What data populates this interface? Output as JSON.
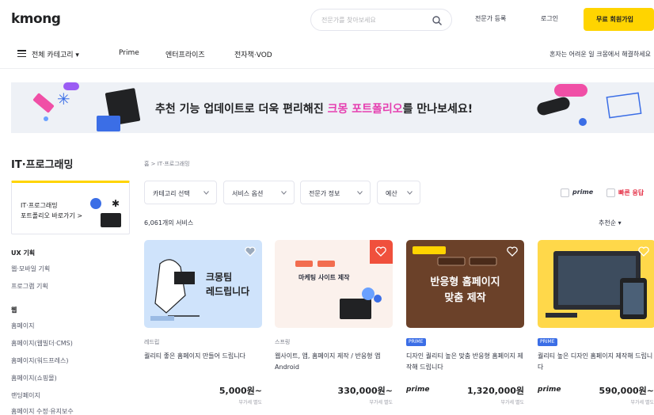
{
  "header": {
    "logo": "kmong",
    "search_placeholder": "전문가를 찾아보세요",
    "links": [
      "전문가 등록",
      "로그인"
    ],
    "join_label": "무료 회원가입"
  },
  "nav": {
    "items": [
      "전체 카테고리 ▾",
      "Prime",
      "엔터프라이즈",
      "전자책·VOD"
    ],
    "right_text": "혼자는 어려운 일 크몽에서 해결하세요"
  },
  "banner": {
    "text_before": "추천 기능 업데이트로 더욱 편리해진 ",
    "highlight": "크몽 포트폴리오",
    "text_after": "를 만나보세요!"
  },
  "sidebar": {
    "title": "IT·프로그래밍",
    "promo": [
      "IT·프로그래밍",
      "포트폴리오 바로가기 >"
    ],
    "sections": [
      {
        "title": "UX 기획",
        "items": [
          "웹·모바일 기획",
          "프로그램 기획"
        ]
      },
      {
        "title": "웹",
        "items": [
          "홈페이지",
          "홈페이지(웹빌더·CMS)",
          "홈페이지(워드프레스)",
          "홈페이지(쇼핑몰)",
          "랜딩페이지",
          "홈페이지 수정·유지보수"
        ]
      }
    ]
  },
  "content": {
    "breadcrumb": "홈 > IT·프로그래밍",
    "filters": [
      "카테고리 선택",
      "서비스 옵션",
      "전문가 정보",
      "예산"
    ],
    "options": [
      "prime",
      "빠른 응답"
    ],
    "count_text": "6,061개의 서비스",
    "sort_label": "추천순 ▾"
  },
  "cards": [
    {
      "thumb_text": "크몽팀\n레드립니다",
      "seller": "레드립",
      "title": "퀄리티 좋은 홈페이지 만들어 드립니다",
      "prime": "",
      "price": "5,000원~",
      "price_sub": "부가세 별도",
      "badge": ""
    },
    {
      "thumb_text": "마케팅 사이트 제작",
      "seller": "스프링",
      "title": "웹사이트, 앱, 홈페이지 제작 / 반응형 앱 Android",
      "prime": "",
      "price": "330,000원~",
      "price_sub": "부가세 별도",
      "badge": ""
    },
    {
      "thumb_text": "반응형 홈페이지\n맞춤 제작",
      "seller": "",
      "title": "디자인 퀄리티 높은 맞춤 반응형 홈페이지 제작해 드립니다",
      "prime": "prime",
      "price": "1,320,000원",
      "price_sub": "부가세 별도",
      "badge": "PRIME"
    },
    {
      "thumb_text": "",
      "seller": "",
      "title": "퀄리티 높은 디자인 홈페이지 제작해 드립니다",
      "prime": "prime",
      "price": "590,000원~",
      "price_sub": "부가세 별도",
      "badge": "PRIME"
    }
  ]
}
